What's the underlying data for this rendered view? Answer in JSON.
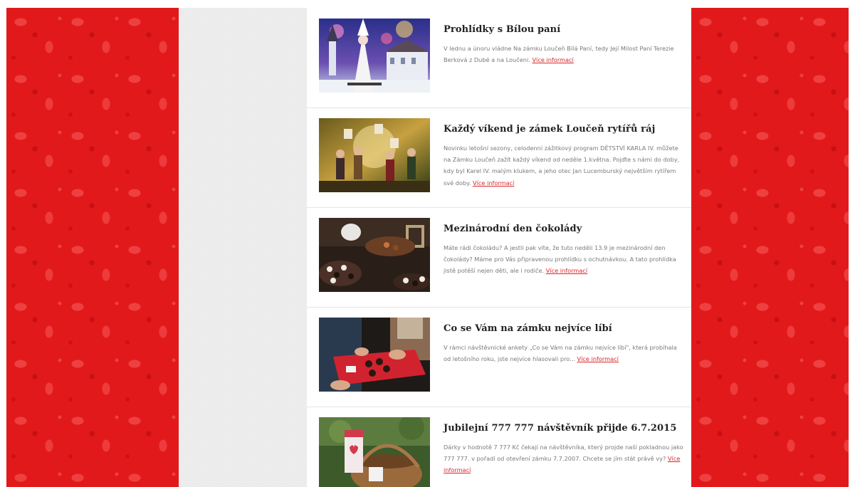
{
  "colors": {
    "damask_red": "#e2191b",
    "paper_grey": "#ececec",
    "title_color": "#222222",
    "text_color": "#7a7a7a",
    "link_color": "#d7262a"
  },
  "articles": [
    {
      "title": "Prohlídky s Bílou paní",
      "text": "V lednu a únoru vládne Na zámku Loučeň Bílá Paní, tedy Její Milost Paní Terezie Berková z Dubé a na Loučeni.",
      "link": "Více informací",
      "image": "white-lady-costume-photo"
    },
    {
      "title": "Každý víkend je zámek Loučeň rytířů ráj",
      "text": "Novinku letošní sezony, celodenní zážitkový program DĚTSTVÍ KARLA IV. můžete na Zámku Loučeň zažít každý víkend od neděle 1.května. Pojďte s námi do doby, kdy byl Karel IV. malým klukem, a jeho otec Jan Lucemburský největším rytířem své doby.",
      "link": "Více informací",
      "image": "knights-children-photo"
    },
    {
      "title": "Mezinárodní den čokolády",
      "text": "Máte rádi čokoládu? A jestli pak víte, že tuto neděli 13.9 je mezinárodní den čokolády? Máme pro Vás připravenou prohlídku s ochutnávkou. A tato prohlídka jistě potěší nejen děti, ale i rodiče.",
      "link": "Více informací",
      "image": "chocolate-pralines-photo"
    },
    {
      "title": "Co se Vám na zámku nejvíce líbí",
      "text": "V rámci návštěvnické ankety „Co se Vám na zámku nejvíce líbí\", která probíhala od letošního roku, jste nejvíce hlasovali pro...",
      "link": "Více informací",
      "image": "hands-chocolate-tray-photo"
    },
    {
      "title": "Jubilejní 777 777 návštěvník přijde 6.7.2015",
      "text": "Dárky v hodnotě 7 777 Kč čekají na návštěvníka, který projde naší pokladnou jako 777 777. v pořadí od otevření zámku 7.7.2007. Chcete se jím stát právě vy?",
      "link": "Více informací",
      "image": "gift-basket-photo"
    }
  ]
}
